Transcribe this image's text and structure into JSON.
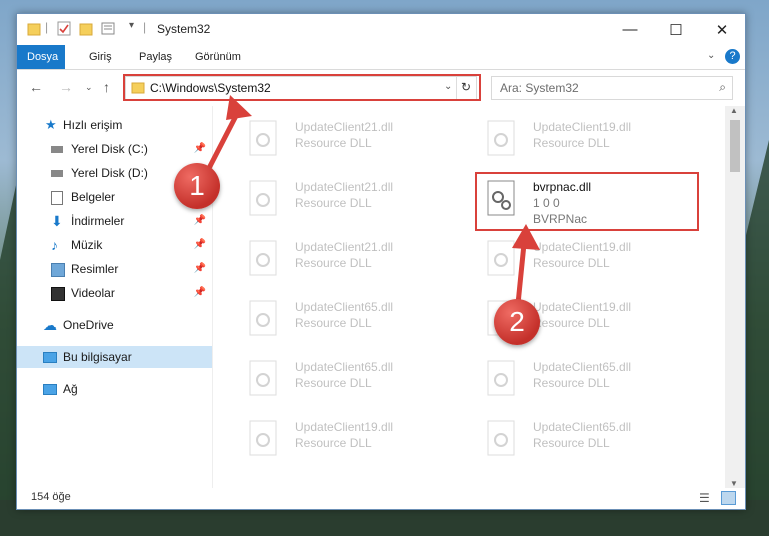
{
  "window": {
    "title": "System32",
    "controls": {
      "minimize": "—",
      "maximize": "☐",
      "close": "✕"
    }
  },
  "ribbon": {
    "tabs": [
      {
        "label": "Dosya",
        "active": true
      },
      {
        "label": "Giriş"
      },
      {
        "label": "Paylaş"
      },
      {
        "label": "Görünüm"
      }
    ],
    "help": "?"
  },
  "address": {
    "path": "C:\\Windows\\System32",
    "search_placeholder": "Ara: System32"
  },
  "sidebar": {
    "items": [
      {
        "label": "Hızlı erişim",
        "icon": "star-icon"
      },
      {
        "label": "Yerel Disk (C:)",
        "icon": "drive-icon",
        "pinned": true
      },
      {
        "label": "Yerel Disk (D:)",
        "icon": "drive-icon"
      },
      {
        "label": "Belgeler",
        "icon": "documents-icon"
      },
      {
        "label": "İndirmeler",
        "icon": "download-icon",
        "pinned": true
      },
      {
        "label": "Müzik",
        "icon": "music-icon",
        "pinned": true
      },
      {
        "label": "Resimler",
        "icon": "pictures-icon",
        "pinned": true
      },
      {
        "label": "Videolar",
        "icon": "video-icon",
        "pinned": true
      },
      {
        "label": "OneDrive",
        "icon": "cloud-icon"
      },
      {
        "label": "Bu bilgisayar",
        "icon": "computer-icon",
        "selected": true
      },
      {
        "label": "Ağ",
        "icon": "network-icon"
      }
    ]
  },
  "files": {
    "left": [
      {
        "name": "UpdateClient21.dll",
        "desc": "Resource DLL"
      },
      {
        "name": "UpdateClient21.dll",
        "desc": "Resource DLL"
      },
      {
        "name": "UpdateClient21.dll",
        "desc": "Resource DLL"
      },
      {
        "name": "UpdateClient65.dll",
        "desc": "Resource DLL"
      },
      {
        "name": "UpdateClient65.dll",
        "desc": "Resource DLL"
      },
      {
        "name": "UpdateClient19.dll",
        "desc": "Resource DLL"
      }
    ],
    "right": [
      {
        "name": "UpdateClient19.dll",
        "desc": "Resource DLL"
      },
      {
        "name": "bvrpnac.dll",
        "desc": "1 0 0",
        "desc2": "BVRPNac",
        "highlight": true
      },
      {
        "name": "UpdateClient19.dll",
        "desc": "Resource DLL"
      },
      {
        "name": "UpdateClient19.dll",
        "desc": "Resource DLL"
      },
      {
        "name": "UpdateClient65.dll",
        "desc": "Resource DLL"
      },
      {
        "name": "UpdateClient65.dll",
        "desc": "Resource DLL"
      }
    ]
  },
  "status": {
    "count": "154 öğe"
  },
  "annotations": {
    "badge1": "1",
    "badge2": "2",
    "color": "#d9413b"
  }
}
